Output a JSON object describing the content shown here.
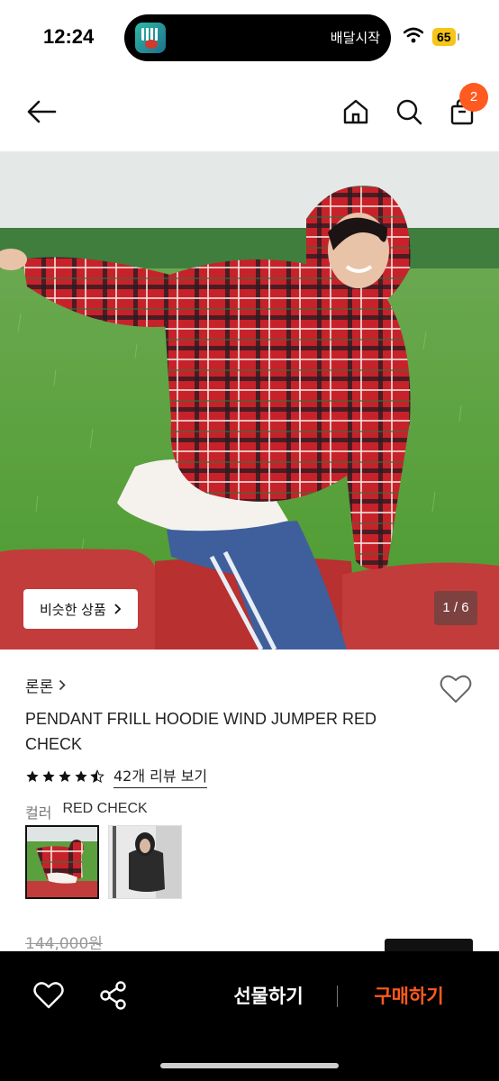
{
  "status_bar": {
    "time": "12:24",
    "live_activity_text": "배달시작",
    "battery": "65"
  },
  "nav": {
    "cart_count": "2"
  },
  "gallery": {
    "similar_button_label": "비슷한 상품",
    "page_indicator": "1 / 6"
  },
  "product": {
    "brand": "론론",
    "title": "PENDANT FRILL HOODIE WIND JUMPER RED CHECK",
    "rating": 4.5,
    "review_link": "42개 리뷰 보기",
    "color_label": "컬러",
    "color_value": "RED CHECK",
    "original_price": "144,000원"
  },
  "bottom_bar": {
    "gift_label": "선물하기",
    "buy_label": "구매하기"
  },
  "colors": {
    "accent": "#ff5a1f",
    "bottom_bar_bg": "#000000"
  }
}
